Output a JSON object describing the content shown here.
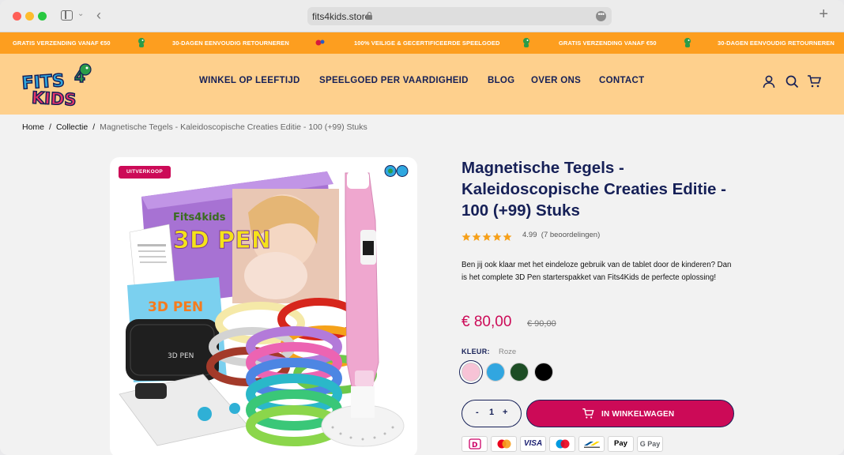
{
  "browser": {
    "url": "fits4kids.store",
    "more_glyph": "•••",
    "back_glyph": "‹",
    "new_tab_glyph": "+",
    "sidebar_chevron": "⌄"
  },
  "announcements": [
    "GRATIS VERZENDING VANAF €50",
    "30-DAGEN EENVOUDIG RETOURNEREN",
    "100% VEILIGE & GECERTIFICEERDE SPEELGOED",
    "GRATIS VERZENDING VANAF €50",
    "30-DAGEN EENVOUDIG RETOURNEREN"
  ],
  "header": {
    "logo_text": "FITS4KIDS",
    "nav": [
      "WINKEL OP LEEFTIJD",
      "SPEELGOED PER VAARDIGHEID",
      "BLOG",
      "OVER ONS",
      "CONTACT"
    ]
  },
  "breadcrumb": {
    "home": "Home",
    "collection": "Collectie",
    "current": "Magnetische Tegels - Kaleidoscopische Creaties Editie - 100 (+99) Stuks",
    "separator": "/"
  },
  "product": {
    "badge": "UITVERKOOP",
    "box_brand": "Fits4kids",
    "box_title": "3D PEN",
    "case_label": "3D PEN",
    "book_title": "3D PEN",
    "title": "Magnetische Tegels - Kaleidoscopische Creaties Editie - 100 (+99) Stuks",
    "rating": 4.99,
    "rating_text": "4.99",
    "reviews_text": "(7 beoordelingen)",
    "description": "Ben jij ook klaar met het eindeloze gebruik van de tablet door de kinderen? Dan is het complete 3D Pen starterspakket van Fits4Kids de perfecte oplossing!",
    "price": "€ 80,00",
    "old_price": "€ 90,00",
    "color_label": "KLEUR:",
    "color_value": "Roze",
    "swatches": [
      "#f7c3d6",
      "#31a6e0",
      "#1d4d25",
      "#000000"
    ],
    "quantity": "1",
    "qty_minus": "-",
    "qty_plus": "+",
    "add_to_cart": "IN WINKELWAGEN"
  },
  "payment_methods": [
    "iDEAL",
    "Mastercard",
    "VISA",
    "Maestro",
    "Bancontact",
    "Apple Pay",
    "G Pay"
  ],
  "payment_labels": {
    "visa": "VISA",
    "applepay": " Pay",
    "gpay": "G Pay"
  },
  "colors": {
    "announce_bg": "#fd9e1f",
    "header_bg": "#fed08d",
    "navy": "#162057",
    "accent": "#cc0a57"
  }
}
